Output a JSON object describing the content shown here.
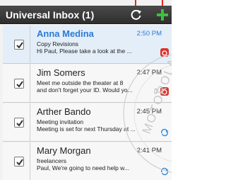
{
  "header": {
    "title": "Universal Inbox (1)",
    "refresh_icon": "refresh-icon",
    "compose_icon": "plus-icon"
  },
  "colors": {
    "header_bg": "#3a3a3a",
    "unread_text": "#2b7ad6",
    "callout": "#e8262a",
    "accent_green": "#3cc33c"
  },
  "messages": [
    {
      "sender": "Anna Medina",
      "time": "2:50 PM",
      "subject": "Copy Revisions",
      "snippet": "Hi Paul, Please take a look at the ...",
      "unread": true,
      "checked": true,
      "source_icon": "email-icon"
    },
    {
      "sender": "Jim Somers",
      "time": "2:47 PM",
      "subject": "Meet me outside the theater at 8",
      "snippet": "and don't forget your ID. Would yo...",
      "unread": false,
      "checked": true,
      "source_icon": "email-icon"
    },
    {
      "sender": "Arther Bando",
      "time": "2:45 PM",
      "subject": "Meeting invitation",
      "snippet": "Meeting is set for next Thursday at ...",
      "unread": false,
      "checked": true,
      "source_icon": "sync-icon"
    },
    {
      "sender": "Mary Morgan",
      "time": "2:41 PM",
      "subject": "freelancers",
      "snippet": "Paul, We're going to need help w...",
      "unread": false,
      "checked": true,
      "source_icon": "sync-icon"
    }
  ],
  "watermark": "MOTOROLA"
}
